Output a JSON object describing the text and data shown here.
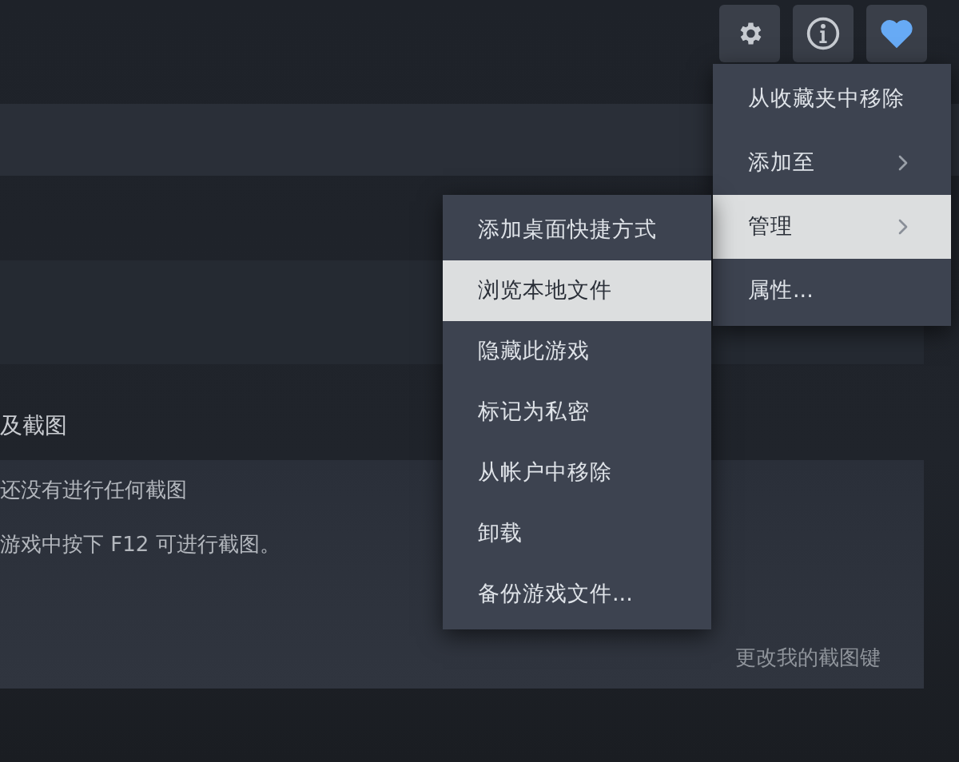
{
  "toolbar": {
    "buttons": [
      {
        "kind": "settings"
      },
      {
        "kind": "info"
      },
      {
        "kind": "favorite"
      }
    ]
  },
  "screenshots": {
    "section_title": "及截图",
    "empty_title": "还没有进行任何截图",
    "hint": "游戏中按下 F12 可进行截图。",
    "link": "更改我的截图键"
  },
  "context_menu": {
    "items": [
      {
        "label": "从收藏夹中移除",
        "has_submenu": false,
        "selected": false
      },
      {
        "label": "添加至",
        "has_submenu": true,
        "selected": false
      },
      {
        "label": "管理",
        "has_submenu": true,
        "selected": true
      },
      {
        "label": "属性...",
        "has_submenu": false,
        "selected": false
      }
    ]
  },
  "submenu": {
    "items": [
      {
        "label": "添加桌面快捷方式",
        "selected": false
      },
      {
        "label": "浏览本地文件",
        "selected": true
      },
      {
        "label": "隐藏此游戏",
        "selected": false
      },
      {
        "label": "标记为私密",
        "selected": false
      },
      {
        "label": "从帐户中移除",
        "selected": false
      },
      {
        "label": "卸载",
        "selected": false
      },
      {
        "label": "备份游戏文件...",
        "selected": false
      }
    ]
  }
}
